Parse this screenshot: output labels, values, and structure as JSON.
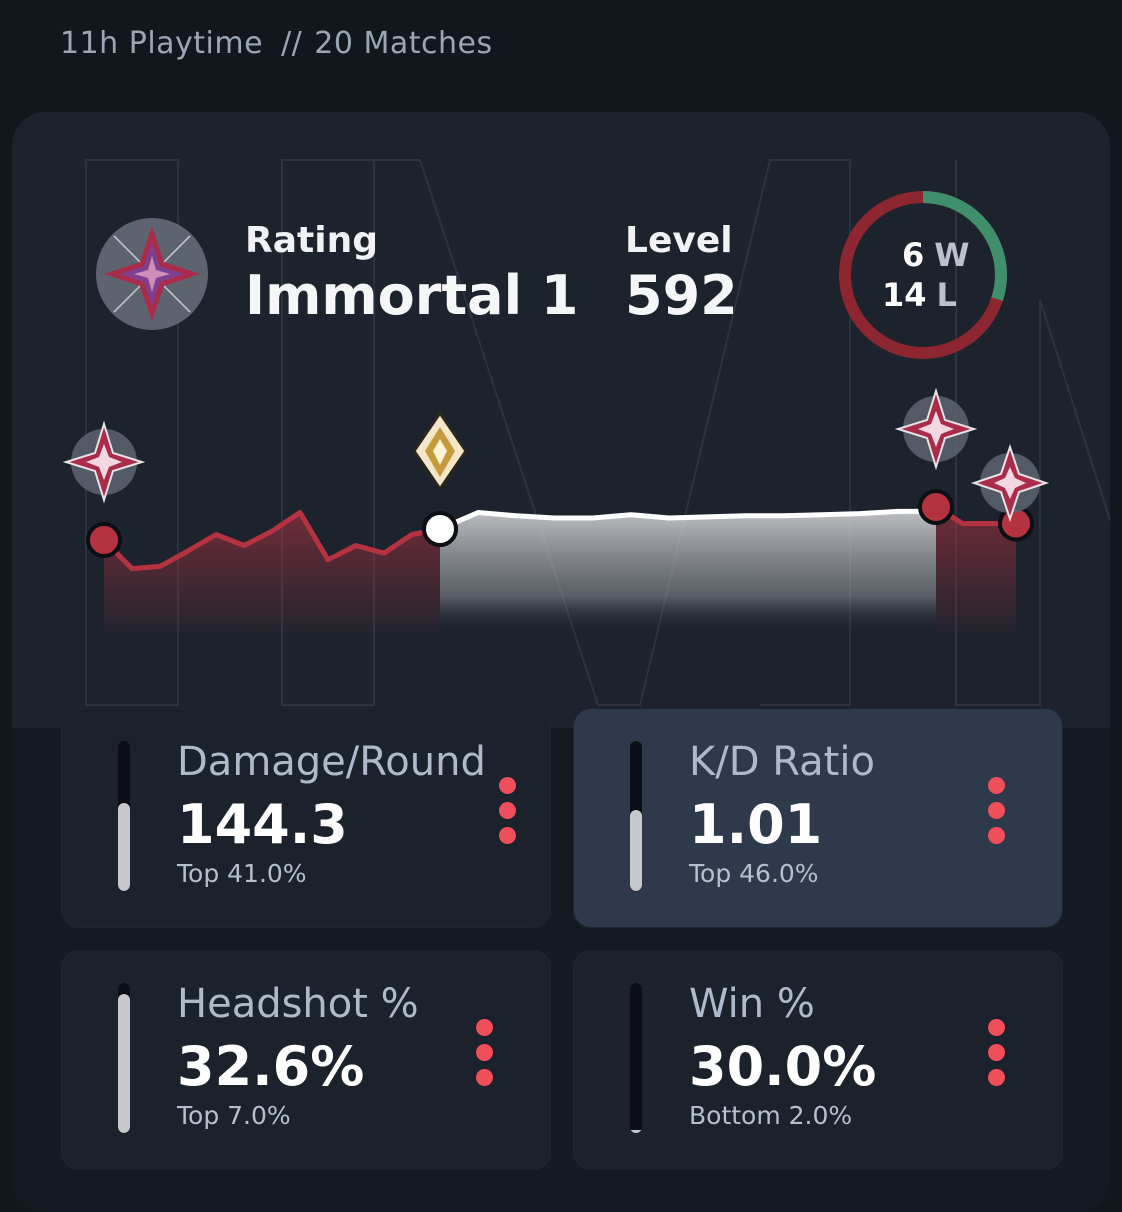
{
  "header": {
    "playtime": "11h Playtime",
    "separator": "//",
    "matches": "20 Matches"
  },
  "rating": {
    "label": "Rating",
    "value": "Immortal 1",
    "badge_icon": "immortal-rank-icon"
  },
  "level": {
    "label": "Level",
    "value": "592"
  },
  "record": {
    "wins": "6",
    "wins_suffix": "W",
    "losses": "14",
    "losses_suffix": "L",
    "win_color": "#3e8f6a",
    "loss_color": "#8e2631"
  },
  "colors": {
    "accent_red": "#b53340",
    "kebab_red": "#ef4f5a",
    "radiant_line": "#ffffff"
  },
  "chart_data": {
    "type": "line",
    "segments": [
      {
        "tier_icon": "immortal-rank-icon",
        "color": "#b53340",
        "values": [
          0.0,
          -0.26,
          -0.24,
          -0.1,
          0.05,
          -0.05,
          0.08,
          0.25,
          -0.18,
          -0.05,
          -0.12,
          0.05,
          0.1
        ]
      },
      {
        "tier_icon": "radiant-rank-icon",
        "color": "#ffffff",
        "values": [
          0.1,
          0.25,
          0.22,
          0.2,
          0.2,
          0.23,
          0.2,
          0.21,
          0.22,
          0.22,
          0.23,
          0.24,
          0.26,
          0.26
        ]
      },
      {
        "tier_icon": "immortal-rank-icon",
        "color": "#b53340",
        "values": [
          0.3,
          0.15,
          0.15,
          0.15
        ]
      }
    ]
  },
  "stats": [
    {
      "label": "Damage/Round",
      "value": "144.3",
      "rank": "Top 41.0%",
      "fill": 0.59
    },
    {
      "label": "K/D Ratio",
      "value": "1.01",
      "rank": "Top 46.0%",
      "fill": 0.54
    },
    {
      "label": "Headshot %",
      "value": "32.6%",
      "rank": "Top 7.0%",
      "fill": 0.93
    },
    {
      "label": "Win %",
      "value": "30.0%",
      "rank": "Bottom 2.0%",
      "fill": 0.02
    }
  ]
}
